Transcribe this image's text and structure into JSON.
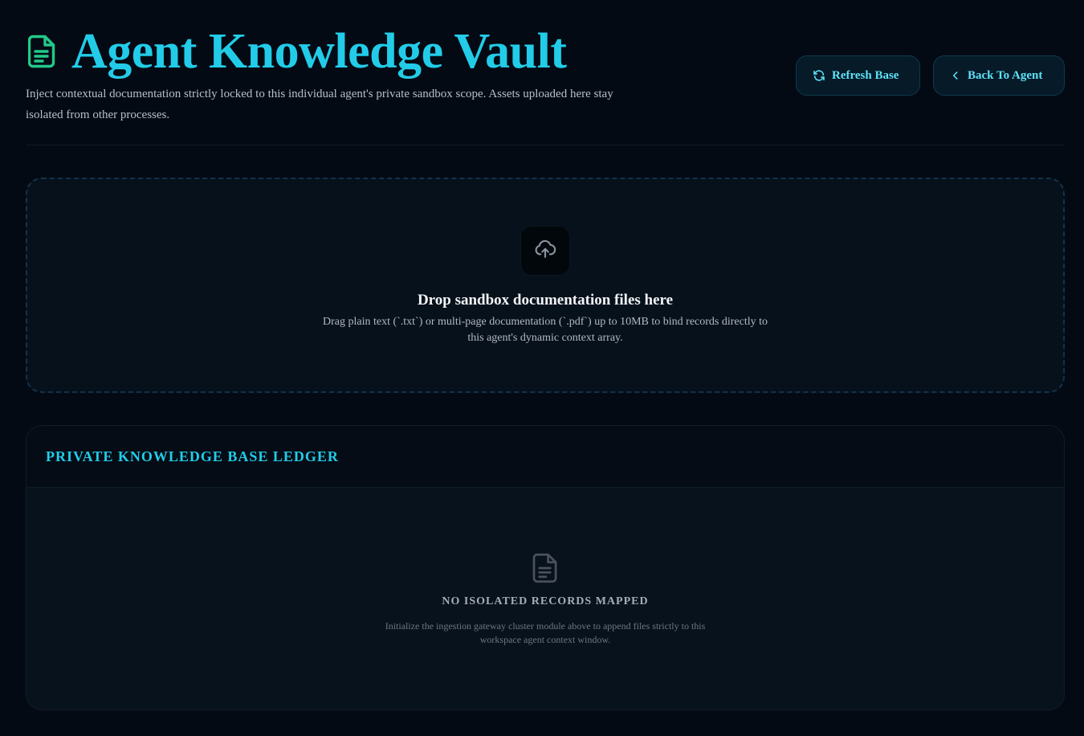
{
  "header": {
    "title": "Agent Knowledge Vault",
    "title_icon": "document-icon",
    "subtitle": "Inject contextual documentation strictly locked to this individual agent's private sandbox scope. Assets uploaded here stay isolated from other processes.",
    "refresh_label": "Refresh Base",
    "refresh_icon": "refresh-icon",
    "back_label": "Back To Agent",
    "back_icon": "chevron-left-icon"
  },
  "dropzone": {
    "icon": "cloud-upload-icon",
    "title": "Drop sandbox documentation files here",
    "description": "Drag plain text (`.txt`) or multi-page documentation (`.pdf`) up to 10MB to bind records directly to this agent's dynamic context array."
  },
  "ledger": {
    "title": "PRIVATE KNOWLEDGE BASE LEDGER",
    "empty_icon": "document-icon",
    "empty_title": "NO ISOLATED RECORDS MAPPED",
    "empty_description": "Initialize the ingestion gateway cluster module above to append files strictly to this workspace agent context window."
  },
  "colors": {
    "background": "#040a14",
    "accent": "#22cce8",
    "title_icon": "#22c98a"
  }
}
